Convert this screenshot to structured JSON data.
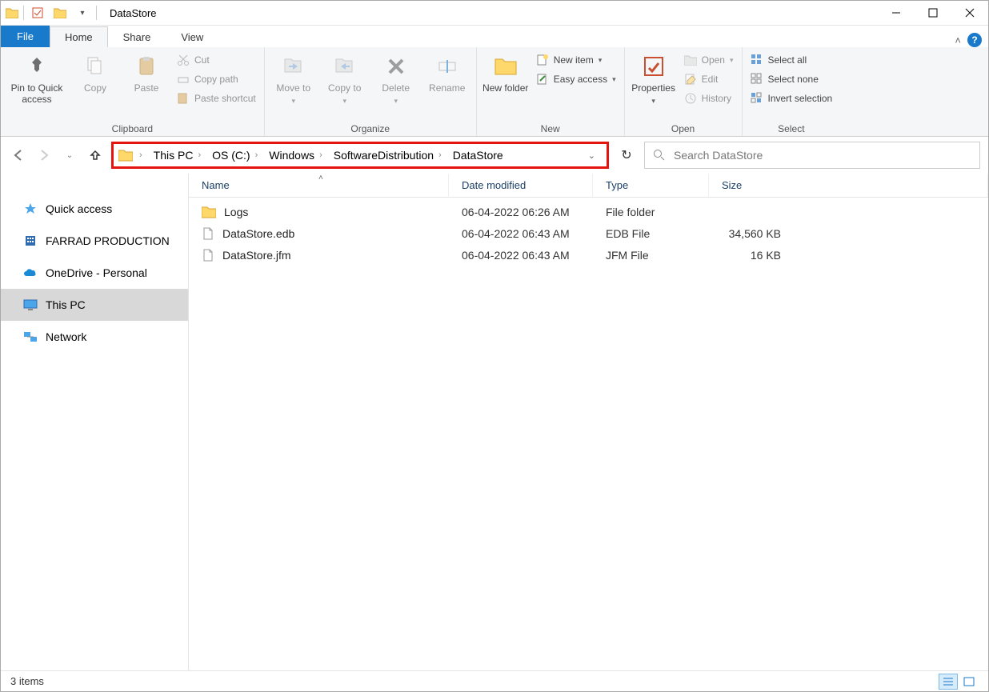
{
  "title": "DataStore",
  "tabs": {
    "file": "File",
    "home": "Home",
    "share": "Share",
    "view": "View"
  },
  "ribbon": {
    "clipboard": {
      "label": "Clipboard",
      "pin": "Pin to Quick access",
      "copy": "Copy",
      "paste": "Paste",
      "cut": "Cut",
      "copy_path": "Copy path",
      "paste_shortcut": "Paste shortcut"
    },
    "organize": {
      "label": "Organize",
      "move_to": "Move to",
      "copy_to": "Copy to",
      "delete": "Delete",
      "rename": "Rename"
    },
    "new": {
      "label": "New",
      "new_folder": "New folder",
      "new_item": "New item",
      "easy_access": "Easy access"
    },
    "open": {
      "label": "Open",
      "properties": "Properties",
      "open": "Open",
      "edit": "Edit",
      "history": "History"
    },
    "select": {
      "label": "Select",
      "select_all": "Select all",
      "select_none": "Select none",
      "invert": "Invert selection"
    }
  },
  "breadcrumb": [
    "This PC",
    "OS (C:)",
    "Windows",
    "SoftwareDistribution",
    "DataStore"
  ],
  "search_placeholder": "Search DataStore",
  "nav_pane": {
    "quick_access": "Quick access",
    "farrad": "FARRAD PRODUCTION",
    "onedrive": "OneDrive - Personal",
    "this_pc": "This PC",
    "network": "Network"
  },
  "columns": {
    "name": "Name",
    "date": "Date modified",
    "type": "Type",
    "size": "Size"
  },
  "files": [
    {
      "name": "Logs",
      "date": "06-04-2022 06:26 AM",
      "type": "File folder",
      "size": "",
      "kind": "folder"
    },
    {
      "name": "DataStore.edb",
      "date": "06-04-2022 06:43 AM",
      "type": "EDB File",
      "size": "34,560 KB",
      "kind": "file"
    },
    {
      "name": "DataStore.jfm",
      "date": "06-04-2022 06:43 AM",
      "type": "JFM File",
      "size": "16 KB",
      "kind": "file"
    }
  ],
  "status": "3 items"
}
